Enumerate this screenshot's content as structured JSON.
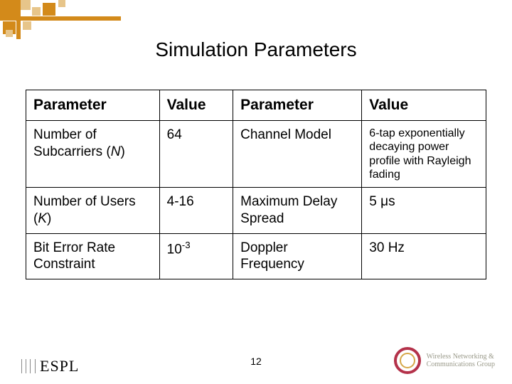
{
  "title": "Simulation Parameters",
  "headers": [
    "Parameter",
    "Value",
    "Parameter",
    "Value"
  ],
  "rows": [
    {
      "p1_pre": "Number of Subcarriers (",
      "p1_it": "N",
      "p1_post": ")",
      "v1": "64",
      "p2": "Channel Model",
      "v2": "6-tap exponentially decaying power profile with Rayleigh fading",
      "v2_small": true
    },
    {
      "p1_pre": "Number of Users (",
      "p1_it": "K",
      "p1_post": ")",
      "v1": "4-16",
      "p2": "Maximum Delay Spread",
      "v2": "5 μs"
    },
    {
      "p1_pre": "Bit Error Rate Constraint",
      "p1_it": "",
      "p1_post": "",
      "v1_base": "10",
      "v1_sup": "-3",
      "p2": "Doppler Frequency",
      "v2": "30 Hz"
    }
  ],
  "pagenum": "12",
  "footer_left": "ESPL",
  "footer_right_line1": "Wireless Networking &",
  "footer_right_line2": "Communications Group"
}
